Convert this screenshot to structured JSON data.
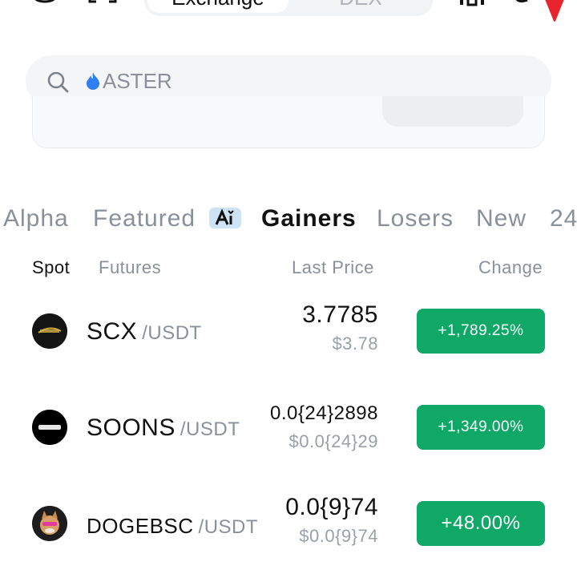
{
  "topbar": {
    "segments": [
      "Exchange",
      "DEX"
    ],
    "colors": {
      "notification_arrow": "#e8252c"
    }
  },
  "search": {
    "placeholder": "ASTER",
    "icons": [
      "search-icon",
      "flame-icon"
    ]
  },
  "categories": [
    "Alpha",
    "Featured",
    "Gainers",
    "Losers",
    "New",
    "24"
  ],
  "active_category": "Gainers",
  "subtabs": [
    "Spot",
    "Futures"
  ],
  "columns": {
    "last_price": "Last Price",
    "change": "Change"
  },
  "rows": [
    {
      "base": "SCX",
      "quote": "/USDT",
      "price": "3.7785",
      "usd": "$3.78",
      "change": "+1,789.25%",
      "logo": "sourcex-logo"
    },
    {
      "base": "SOONS",
      "quote": "/USDT",
      "price": "0.0{24}2898",
      "usd": "$0.0{24}29",
      "change": "+1,349.00%",
      "logo": "soons-logo"
    },
    {
      "base": "DOGEBSC",
      "quote": "/USDT",
      "price": "0.0{9}74",
      "usd": "$0.0{9}74",
      "change": "+48.00%",
      "logo": "dogebsc-logo"
    }
  ],
  "colors": {
    "positive": "#10a866",
    "muted_text": "#8a9099",
    "flame_blue": "#2f7ff0"
  }
}
